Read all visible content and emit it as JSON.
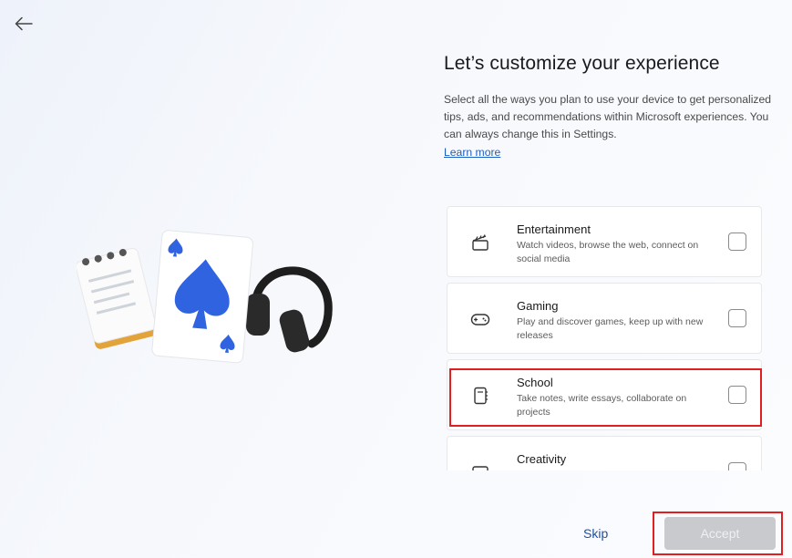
{
  "header": {
    "title": "Let’s customize your experience",
    "description": "Select all the ways you plan to use your device to get personalized tips, ads, and recommendations within Microsoft experiences. You can always change this in Settings.",
    "learn_more": "Learn more"
  },
  "options": [
    {
      "name": "Entertainment",
      "desc": "Watch videos, browse the web, connect on social media",
      "icon": "clapperboard-icon",
      "checked": false
    },
    {
      "name": "Gaming",
      "desc": "Play and discover games, keep up with new releases",
      "icon": "game-controller-icon",
      "checked": false
    },
    {
      "name": "School",
      "desc": "Take notes, write essays, collaborate on projects",
      "icon": "notebook-icon",
      "checked": false
    },
    {
      "name": "Creativity",
      "desc": "",
      "icon": "creativity-icon",
      "checked": false
    }
  ],
  "footer": {
    "skip": "Skip",
    "accept": "Accept"
  },
  "colors": {
    "link": "#1f5fbf",
    "highlight": "#e02020",
    "accept_disabled_bg": "#c8cacd"
  }
}
